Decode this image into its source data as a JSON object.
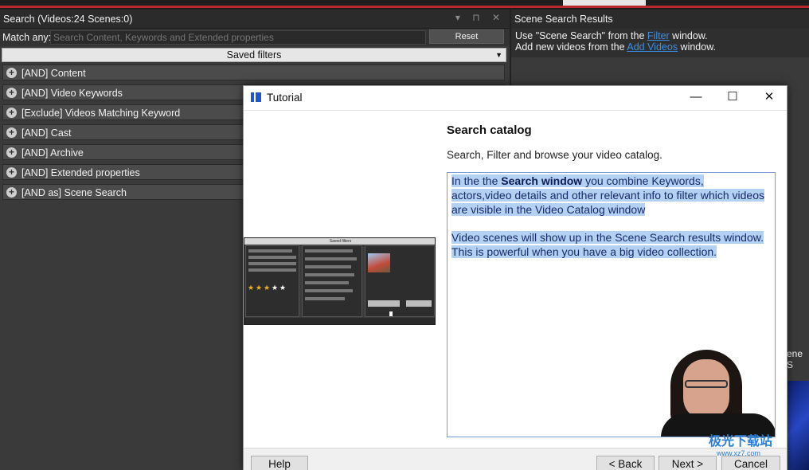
{
  "search": {
    "title": "Search (Videos:24 Scenes:0)",
    "window_controls": "▾ ⊓ ✕",
    "match_label": "Match any:",
    "input_placeholder": "Search Content, Keywords and Extended properties",
    "reset_label": "Reset",
    "saved_filters_label": "Saved filters",
    "filters": [
      {
        "label": "[AND] Content"
      },
      {
        "label": "[AND] Video Keywords"
      },
      {
        "label": "[Exclude] Videos Matching Keyword"
      },
      {
        "label": "[AND] Cast"
      },
      {
        "label": "[AND] Archive"
      },
      {
        "label": "[AND] Extended properties"
      },
      {
        "label": "[AND as] Scene Search"
      }
    ]
  },
  "scene_results": {
    "title": "Scene Search Results",
    "line1_before": "Use \"Scene Search\" from the ",
    "line1_link": "Filter",
    "line1_after": " window.",
    "line2_before": "Add new videos from the ",
    "line2_link": "Add Videos",
    "line2_after": " window.",
    "edge_text": "ene S"
  },
  "tutorial": {
    "title": "Tutorial",
    "heading": "Search catalog",
    "subheading": "Search, Filter and browse your video catalog.",
    "para1_pre": "In the the ",
    "para1_bold": "Search window",
    "para1_post": " you combine Keywords, actors,video details and other relevant info to filter which videos are visible in the Video Catalog window",
    "para2": "Video scenes will show up in the Scene Search results window. This is powerful when you have a big video collection.",
    "preview_bar_label": "Saved filters",
    "buttons": {
      "help": "Help",
      "back": "< Back",
      "next": "Next >",
      "cancel": "Cancel"
    }
  },
  "watermark": {
    "brand": "极光下载站",
    "url": "www.xz7.com"
  },
  "colors": {
    "accent_red": "#b8282b",
    "link_blue": "#3b8fe6",
    "highlight": "#b3d1f2"
  }
}
